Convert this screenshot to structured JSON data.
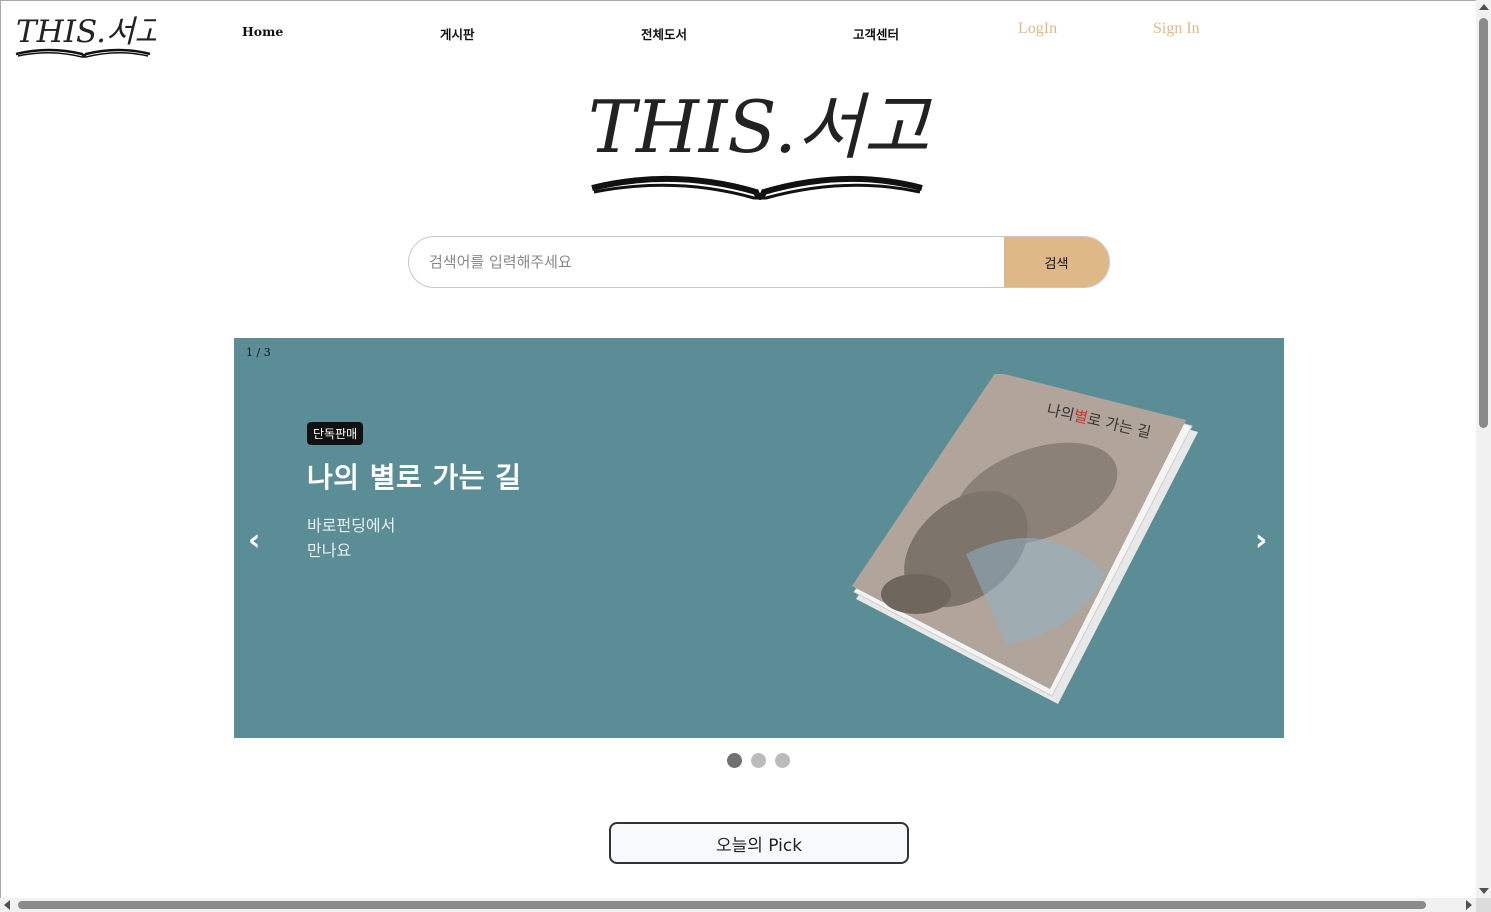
{
  "header": {
    "logo_text": "THIS.서고",
    "nav": [
      {
        "label": "Home"
      },
      {
        "label": "게시판"
      },
      {
        "label": "전체도서"
      },
      {
        "label": "고객센터"
      }
    ],
    "login_label": "LogIn",
    "signin_label": "Sign In",
    "auth_color": "#deb887"
  },
  "hero": {
    "logo_text": "THIS.서고"
  },
  "search": {
    "placeholder": "검색어를 입력해주세요",
    "button_label": "검색",
    "button_color": "#deb887"
  },
  "carousel": {
    "counter": "1 / 3",
    "background_color": "#5a8d96",
    "badge": "단독판매",
    "title": "나의 별로 가는 길",
    "subtitle_line1": "바로펀딩에서",
    "subtitle_line2": "만나요",
    "book_cover_title_pre": "나의",
    "book_cover_title_highlight": "별",
    "book_cover_title_post": "로 가는 길",
    "prev_icon": "chevron-left",
    "next_icon": "chevron-right",
    "active_slide": 1,
    "total_slides": 3
  },
  "today_pick": {
    "label": "오늘의 Pick"
  }
}
